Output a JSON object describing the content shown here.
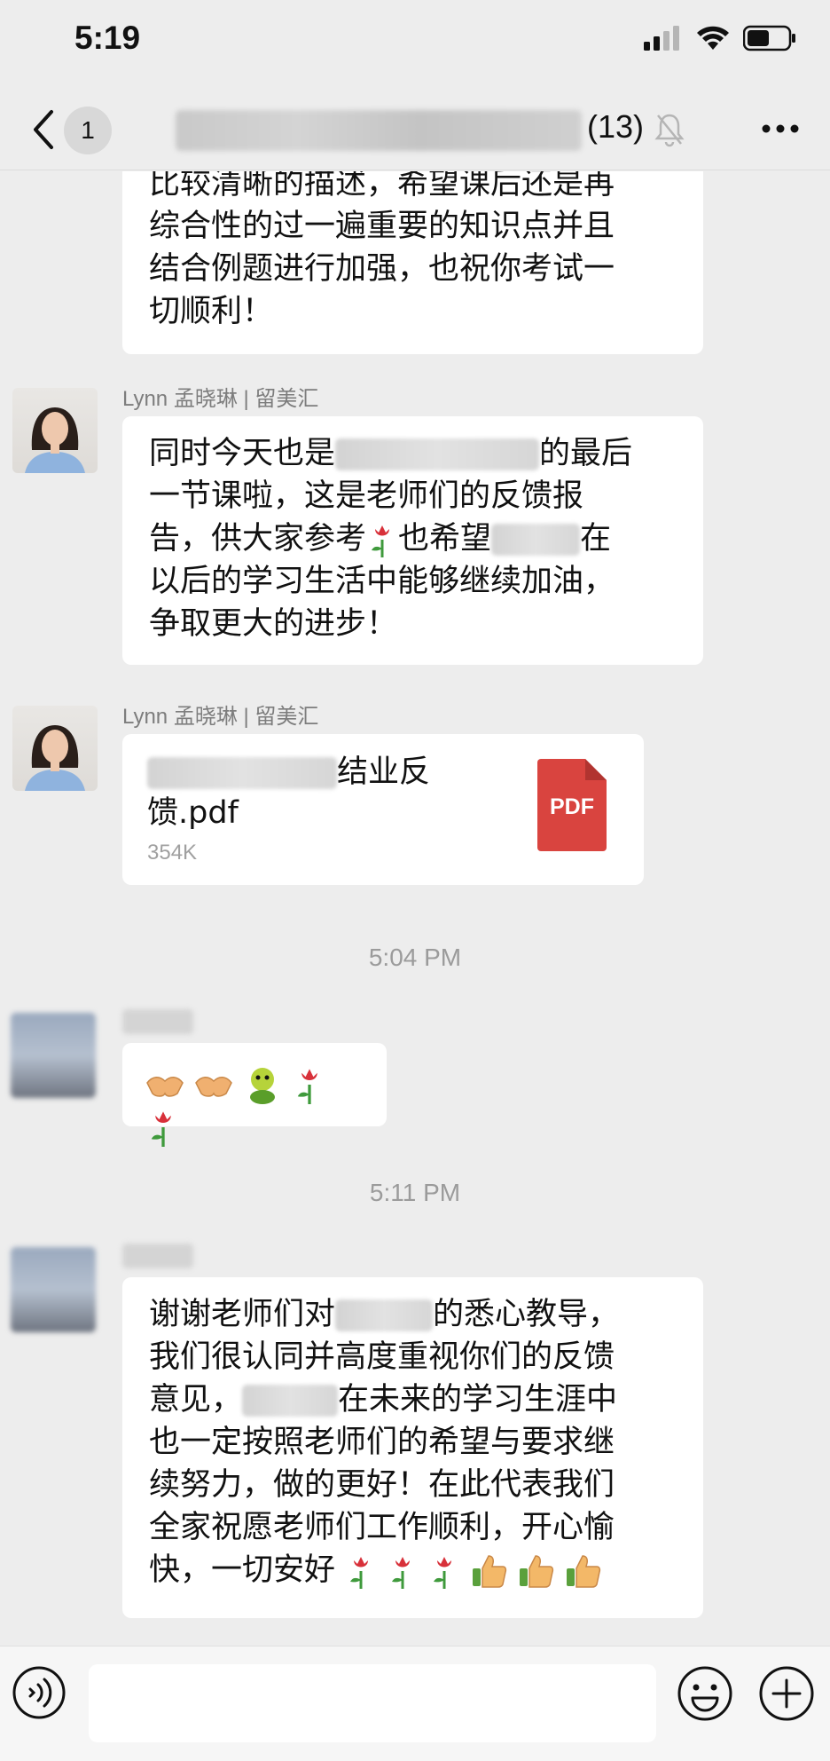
{
  "status_bar": {
    "time": "5:19"
  },
  "nav": {
    "unread_count": "1",
    "member_count": "(13)"
  },
  "messages": {
    "m0": {
      "lines": [
        "比较清晰的描述，希望课后还是再",
        "综合性的过一遍重要的知识点并且",
        "结合例题进行加强，也祝你考试一",
        "切顺利！"
      ]
    },
    "m1": {
      "sender": "Lynn 孟晓琳 | 留美汇",
      "l1_pre": "同时今天也是",
      "l1_post": "的最后",
      "l2": "一节课啦，这是老师们的反馈报",
      "l3_pre": "告，供大家参考",
      "l3_mid": "也希望",
      "l3_post": "在",
      "l4": "以后的学习生活中能够继续加油，",
      "l5": "争取更大的进步！"
    },
    "m2": {
      "sender": "Lynn 孟晓琳 | 留美汇",
      "file_name_l1": "结业反",
      "file_name_l2": "馈.pdf",
      "file_size": "354K",
      "file_type": "PDF"
    },
    "time1": "5:04 PM",
    "time2": "5:11 PM",
    "m4": {
      "l1_pre": "谢谢老师们对",
      "l1_post": "的悉心教导，",
      "l2": "我们很认同并高度重视你们的反馈",
      "l3_pre": "意见，",
      "l3_post": "在未来的学习生涯中",
      "l4": "也一定按照老师们的希望与要求继",
      "l5": "续努力，做的更好！在此代表我们",
      "l6": "全家祝愿老师们工作顺利，开心愉",
      "l7": "快，一切安好"
    }
  },
  "icons": {
    "back": "chevron-left-icon",
    "mute": "bell-slash-icon",
    "more": "ellipsis-icon",
    "voice": "voice-icon",
    "emoji": "smiley-icon",
    "plus": "plus-icon",
    "rose": "rose-emoji",
    "handshake": "handshake-emoji",
    "thumbs": "thumbs-up-emoji",
    "frog": "green-figure-emoji"
  },
  "colors": {
    "background": "#ededed",
    "bubble": "#ffffff",
    "pdf_red": "#d9443f",
    "meta_text": "#9b9b9b"
  }
}
